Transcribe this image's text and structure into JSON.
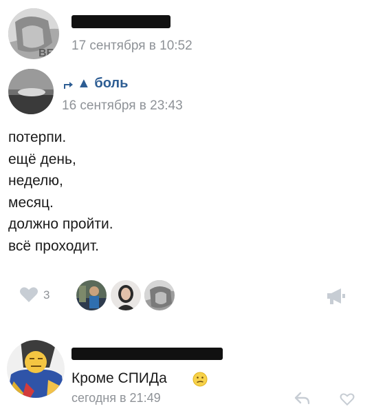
{
  "post": {
    "author_avatar": "user-avatar",
    "timestamp": "17 сентября в 10:52",
    "avatar_print": "BE"
  },
  "repost": {
    "icon": "repost-arrow-icon",
    "source_name": "▲ боль",
    "timestamp": "16 сентября в 23:43"
  },
  "content": {
    "lines": [
      "потерпи.",
      "ещё день,",
      "неделю,",
      "месяц.",
      "должно пройти.",
      "всё проходит."
    ]
  },
  "actions": {
    "likes_count": "3",
    "like_icon": "heart-icon",
    "share_icon": "megaphone-icon",
    "likers": [
      "liker-avatar-1",
      "liker-avatar-2",
      "liker-avatar-3"
    ]
  },
  "comment": {
    "text": "Кроме СПИДа",
    "emoji": "confused-face-emoji",
    "timestamp": "сегодня в 21:49",
    "reply_icon": "reply-arrow-icon",
    "like_icon": "heart-icon"
  },
  "colors": {
    "link": "#2d5d93",
    "muted": "#8e9297",
    "icon": "#c7cdd4"
  }
}
